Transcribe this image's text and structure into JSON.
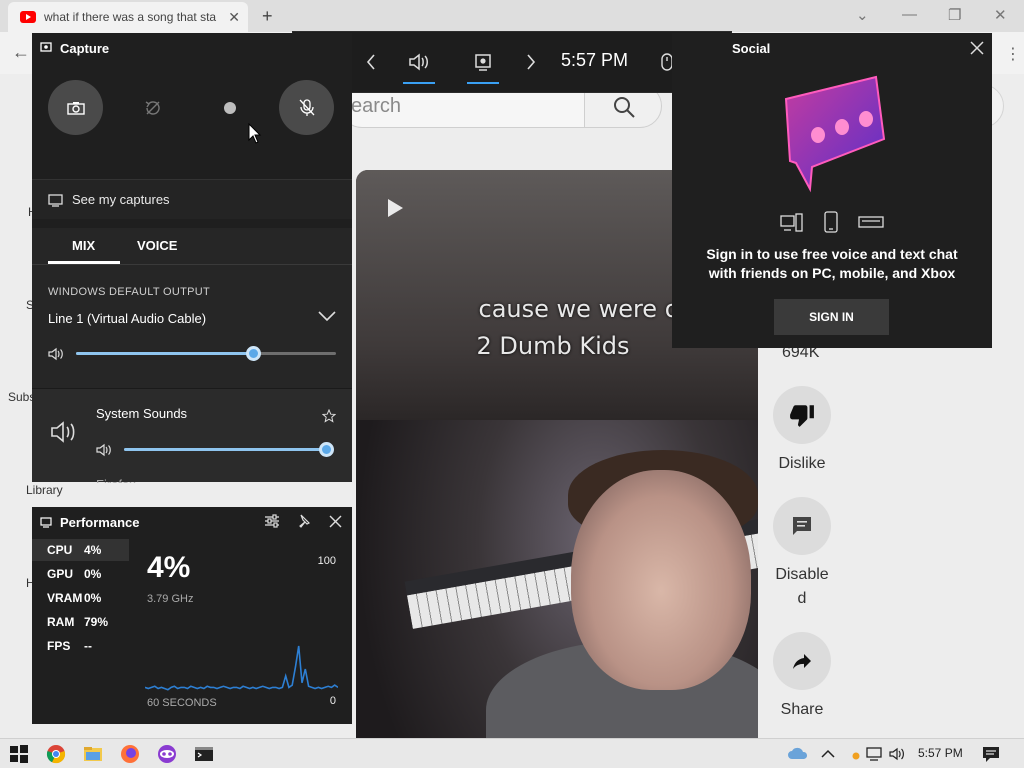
{
  "browser": {
    "tab_title": "what if there was a song that sta",
    "search_placeholder": "earch",
    "sidebar_labels": [
      "H",
      "S",
      "Subs",
      "Library",
      "H"
    ]
  },
  "video": {
    "caption_line1": "cause we were only",
    "caption_line2": "2 Dumb Kids"
  },
  "actions": {
    "likes": "694K",
    "dislike": "Dislike",
    "comments_line1": "Disable",
    "comments_line2": "d",
    "share": "Share"
  },
  "xbox_bar": {
    "time": "5:57 PM",
    "icons": [
      "widget-menu-icon",
      "chevron-left-icon",
      "audio-icon",
      "capture-icon",
      "chevron-right-icon",
      "mouse-icon",
      "settings-icon"
    ],
    "accent": "#3aa0f3"
  },
  "capture": {
    "title": "Capture",
    "see_captures": "See my captures",
    "tab_mix": "MIX",
    "tab_voice": "VOICE",
    "output_label": "WINDOWS DEFAULT OUTPUT",
    "device": "Line 1 (Virtual Audio Cable)",
    "master_volume_pct": 68,
    "system_sounds": "System Sounds",
    "system_volume_pct": 100,
    "next_app": "Firefox"
  },
  "performance": {
    "title": "Performance",
    "rows": [
      {
        "label": "CPU",
        "value": "4%"
      },
      {
        "label": "GPU",
        "value": "0%"
      },
      {
        "label": "VRAM",
        "value": "0%"
      },
      {
        "label": "RAM",
        "value": "79%"
      },
      {
        "label": "FPS",
        "value": "--"
      }
    ],
    "big_value": "4%",
    "frequency": "3.79 GHz",
    "max_label": "100",
    "min_label": "0",
    "window_label": "60 SECONDS",
    "cpu_history": [
      4,
      3,
      4,
      5,
      3,
      4,
      3,
      2,
      4,
      5,
      3,
      4,
      4,
      3,
      5,
      4,
      3,
      4,
      3,
      5,
      4,
      4,
      3,
      4,
      5,
      4,
      3,
      4,
      4,
      3,
      5,
      4,
      3,
      4,
      3,
      4,
      5,
      4,
      3,
      4,
      4,
      3,
      4,
      14,
      4,
      6,
      22,
      40,
      8,
      20,
      5,
      4,
      3,
      4,
      3,
      4,
      5,
      4,
      6,
      4
    ]
  },
  "social": {
    "title": "Social",
    "message": "Sign in to use free voice and text chat with friends on PC, mobile, and Xbox",
    "sign_in": "SIGN IN"
  },
  "taskbar": {
    "time": "5:57 PM"
  }
}
